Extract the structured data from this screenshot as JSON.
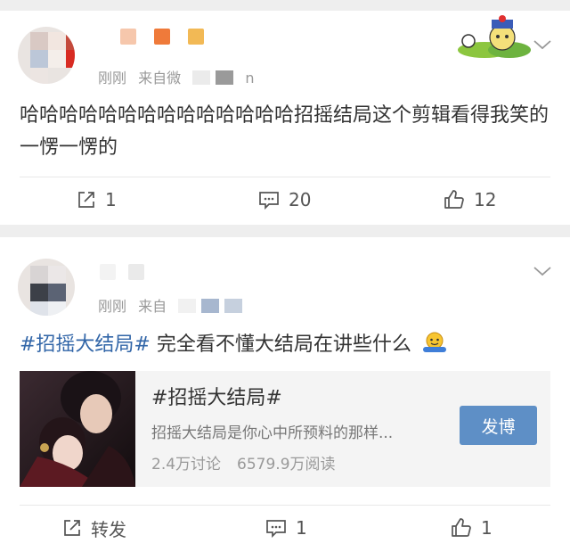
{
  "posts": [
    {
      "time": "刚刚",
      "source_prefix": "来自微",
      "source_suffix": "n",
      "text": "哈哈哈哈哈哈哈哈哈哈哈哈哈哈招摇结局这个剪辑看得我笑的一愣一愣的",
      "actions": {
        "repost": "1",
        "comment": "20",
        "like": "12"
      }
    },
    {
      "time": "刚刚",
      "source_prefix": "来自",
      "topic": "#招摇大结局#",
      "text": " 完全看不懂大结局在讲些什么",
      "share": {
        "title": "#招摇大结局#",
        "desc": "招摇大结局是你心中所预料的那样...",
        "discussions": "2.4万讨论",
        "reads": "6579.9万阅读",
        "button": "发博"
      },
      "actions": {
        "repost": "转发",
        "comment": "1",
        "like": "1"
      }
    }
  ],
  "icons": [
    "repost-icon",
    "comment-icon",
    "like-icon",
    "chevron-down-icon",
    "sticker-icon",
    "emoji-icon"
  ],
  "colors": {
    "topic": "#3266a8",
    "button": "#5e8fc6",
    "background": "#eeeeee"
  }
}
